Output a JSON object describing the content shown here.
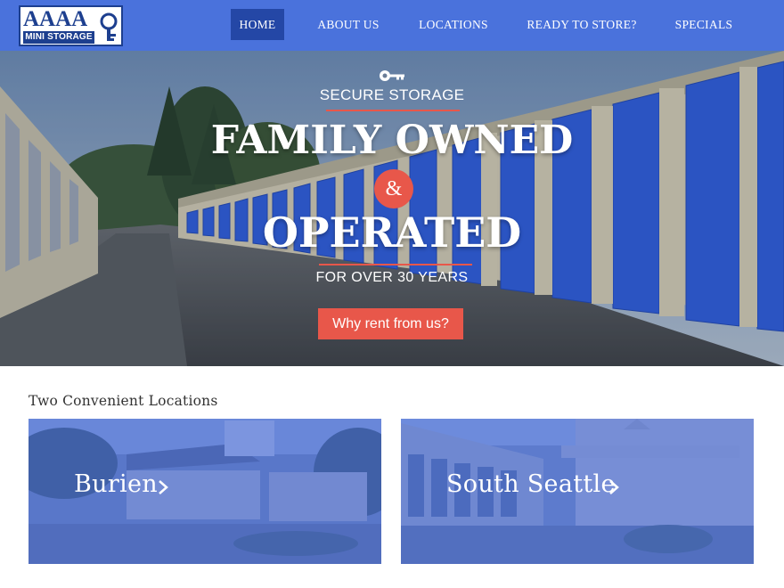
{
  "brand": {
    "logo_top": "AAAA",
    "logo_bottom": "MINI STORAGE"
  },
  "nav": {
    "items": [
      {
        "label": "HOME",
        "active": true
      },
      {
        "label": "ABOUT US",
        "active": false
      },
      {
        "label": "LOCATIONS",
        "active": false
      },
      {
        "label": "READY TO STORE?",
        "active": false
      },
      {
        "label": "SPECIALS",
        "active": false
      }
    ]
  },
  "hero": {
    "icon": "key-icon",
    "eyebrow": "SECURE STORAGE",
    "headline_1": "FAMILY OWNED",
    "ampersand": "&",
    "headline_2": "OPERATED",
    "subline": "FOR OVER 30 YEARS",
    "cta_label": "Why rent from us?"
  },
  "locations": {
    "title": "Two Convenient Locations",
    "cards": [
      {
        "label": "Burien",
        "icon": "chevron-right-icon"
      },
      {
        "label": "South Seattle",
        "icon": "chevron-right-icon"
      }
    ]
  },
  "colors": {
    "nav_bg": "#4a72dc",
    "nav_active": "#2447a6",
    "accent": "#e8574a",
    "door_blue": "#2f5fe0",
    "card_tint": "#3862de"
  }
}
